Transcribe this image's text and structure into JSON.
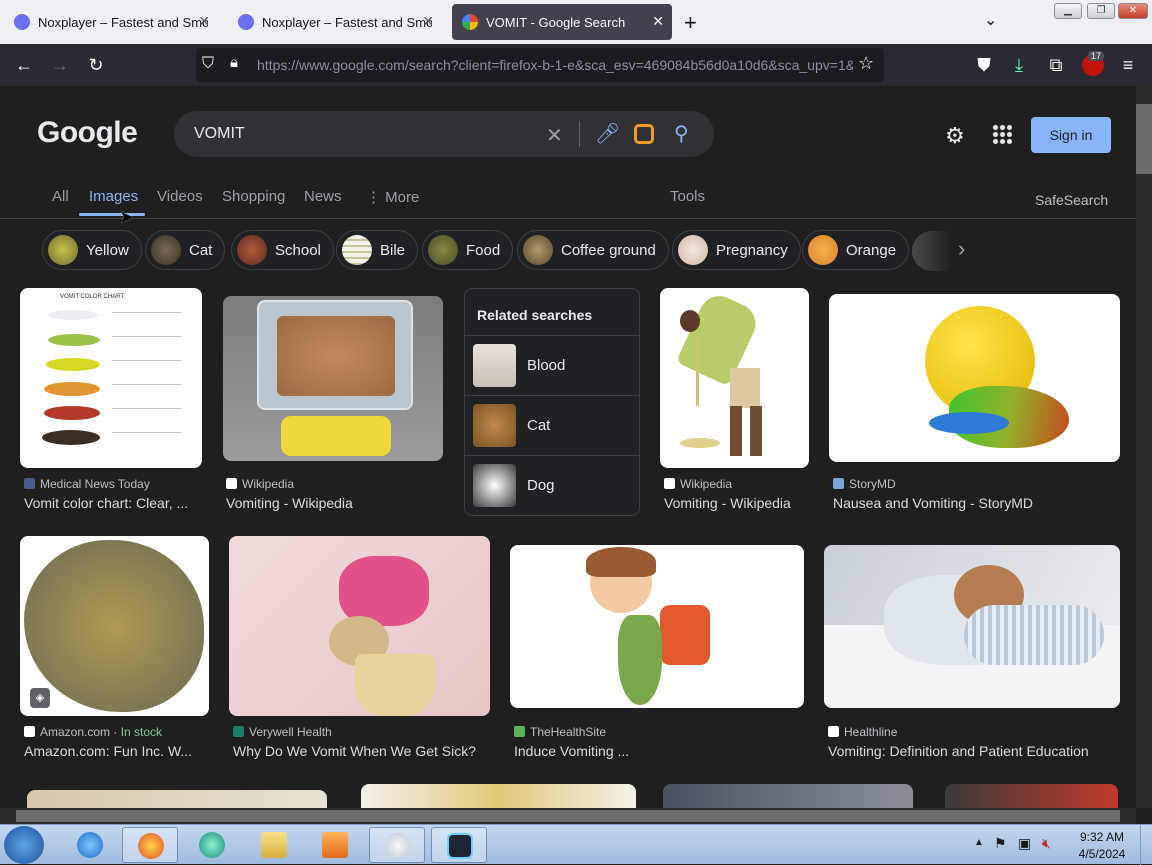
{
  "browser": {
    "tabs": [
      {
        "title": "Noxplayer – Fastest and Smooth",
        "active": false
      },
      {
        "title": "Noxplayer – Fastest and Smooth",
        "active": false
      },
      {
        "title": "VOMIT - Google Search",
        "active": true
      }
    ],
    "new_tab": "+",
    "url": "https://www.google.com/search?client=firefox-b-1-e&sca_esv=469084b56d0a10d6&sca_upv=1&",
    "extension_badge": "17"
  },
  "google": {
    "logo": "Google",
    "query": "VOMIT",
    "sign_in": "Sign in",
    "tabs": [
      "All",
      "Images",
      "Videos",
      "Shopping",
      "News",
      "More"
    ],
    "active_tab": "Images",
    "tools": "Tools",
    "safesearch": "SafeSearch",
    "chips": [
      "Yellow",
      "Cat",
      "School",
      "Bile",
      "Food",
      "Coffee ground",
      "Pregnancy",
      "Orange"
    ],
    "related": {
      "title": "Related searches",
      "items": [
        "Blood",
        "Cat",
        "Dog"
      ]
    },
    "results_row1": [
      {
        "source": "Medical News Today",
        "title": "Vomit color chart: Clear, ..."
      },
      {
        "source": "Wikipedia",
        "title": "Vomiting - Wikipedia"
      },
      {
        "source": "Wikipedia",
        "title": "Vomiting - Wikipedia"
      },
      {
        "source": "StoryMD",
        "title": "Nausea and Vomiting - StoryMD"
      }
    ],
    "results_row2": [
      {
        "source": "Amazon.com",
        "stock": "In stock",
        "title": "Amazon.com: Fun Inc. W..."
      },
      {
        "source": "Verywell Health",
        "title": "Why Do We Vomit When We Get Sick?"
      },
      {
        "source": "TheHealthSite",
        "title": "Induce Vomiting ..."
      },
      {
        "source": "Healthline",
        "title": "Vomiting: Definition and Patient Education"
      }
    ],
    "chart_image": {
      "title": "VOMIT COLOR CHART",
      "items": [
        "CLEAR",
        "GREEN",
        "YELLOW",
        "ORANGE",
        "RED",
        "BROWN/BLACK"
      ]
    }
  },
  "taskbar": {
    "time": "9:32 AM",
    "date": "4/5/2024"
  },
  "colors": {
    "accent": "#8ab4f8",
    "page_bg": "#1f1f1f",
    "sign_in_bg": "#8ab4f8"
  }
}
